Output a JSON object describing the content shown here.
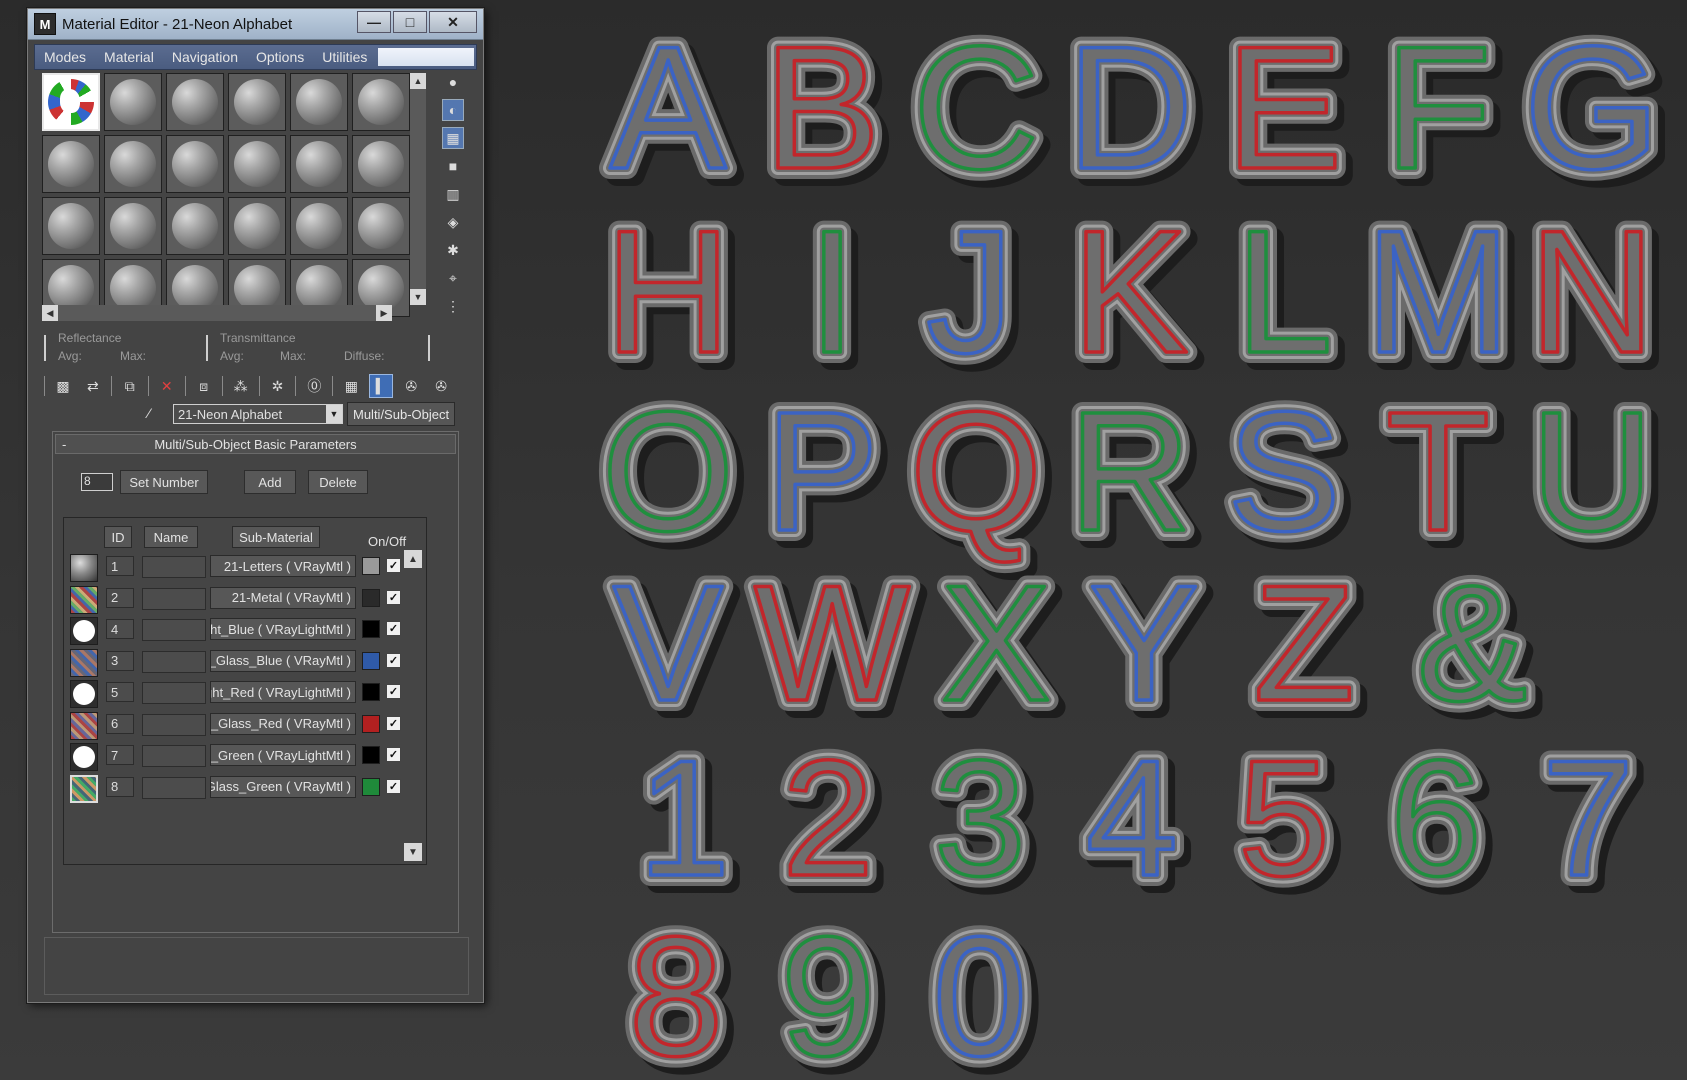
{
  "window": {
    "app_icon": "M",
    "title": "Material Editor - 21-Neon Alphabet",
    "buttons": {
      "minimize": "—",
      "maximize": "□",
      "close": "✕"
    }
  },
  "menu": [
    "Modes",
    "Material",
    "Navigation",
    "Options",
    "Utilities"
  ],
  "reflectance": {
    "label": "Reflectance",
    "avg": "Avg:",
    "max": "Max:"
  },
  "transmittance": {
    "label": "Transmittance",
    "avg": "Avg:",
    "max": "Max:",
    "diffuse": "Diffuse:"
  },
  "material_name": "21-Neon Alphabet",
  "material_type": "Multi/Sub-Object",
  "rollout": {
    "title": "Multi/Sub-Object Basic Parameters",
    "collapse": "-",
    "count_value": "8",
    "set_number": "Set Number",
    "add": "Add",
    "delete": "Delete",
    "headers": {
      "id": "ID",
      "name": "Name",
      "sub_material": "Sub-Material",
      "on_off": "On/Off"
    }
  },
  "rows": [
    {
      "id": "1",
      "material": "21-Letters  ( VRayMtl )",
      "swatch": "#9a9a9a",
      "thumb": "sphere"
    },
    {
      "id": "2",
      "material": "21-Metal  ( VRayMtl )",
      "swatch": "#2a2a2a",
      "thumb": "metal"
    },
    {
      "id": "4",
      "material": "ght_Blue  ( VRayLightMtl )",
      "swatch": "#000000",
      "thumb": "white"
    },
    {
      "id": "3",
      "material": "on_Glass_Blue  ( VRayMtl )",
      "swatch": "#2f5aa8",
      "thumb": "glass-blue"
    },
    {
      "id": "5",
      "material": "ight_Red  ( VRayLightMtl )",
      "swatch": "#000000",
      "thumb": "white"
    },
    {
      "id": "6",
      "material": "on_Glass_Red  ( VRayMtl )",
      "swatch": "#b22020",
      "thumb": "glass-red"
    },
    {
      "id": "7",
      "material": "nt_Green  ( VRayLightMtl )",
      "swatch": "#000000",
      "thumb": "white"
    },
    {
      "id": "8",
      "material": "_Glass_Green  ( VRayMtl )",
      "swatch": "#1f8a3a",
      "thumb": "glass-green"
    }
  ],
  "neon_colors": {
    "blue": "#3b63c4",
    "red": "#c2262b",
    "green": "#1f8f3e"
  },
  "glyphs": [
    {
      "char": "A",
      "color": "blue"
    },
    {
      "char": "B",
      "color": "red"
    },
    {
      "char": "C",
      "color": "green"
    },
    {
      "char": "D",
      "color": "blue"
    },
    {
      "char": "E",
      "color": "red"
    },
    {
      "char": "F",
      "color": "green"
    },
    {
      "char": "G",
      "color": "blue"
    },
    {
      "char": "H",
      "color": "red"
    },
    {
      "char": "I",
      "color": "green"
    },
    {
      "char": "J",
      "color": "blue"
    },
    {
      "char": "K",
      "color": "red"
    },
    {
      "char": "L",
      "color": "green"
    },
    {
      "char": "M",
      "color": "blue"
    },
    {
      "char": "N",
      "color": "red"
    },
    {
      "char": "O",
      "color": "green"
    },
    {
      "char": "P",
      "color": "blue"
    },
    {
      "char": "Q",
      "color": "red"
    },
    {
      "char": "R",
      "color": "green"
    },
    {
      "char": "S",
      "color": "blue"
    },
    {
      "char": "T",
      "color": "red"
    },
    {
      "char": "U",
      "color": "green"
    },
    {
      "char": "V",
      "color": "blue"
    },
    {
      "char": "W",
      "color": "red"
    },
    {
      "char": "X",
      "color": "green"
    },
    {
      "char": "Y",
      "color": "blue"
    },
    {
      "char": "Z",
      "color": "red"
    },
    {
      "char": "&",
      "color": "green"
    },
    {
      "char": "1",
      "color": "blue"
    },
    {
      "char": "2",
      "color": "red"
    },
    {
      "char": "3",
      "color": "green"
    },
    {
      "char": "4",
      "color": "blue"
    },
    {
      "char": "5",
      "color": "red"
    },
    {
      "char": "6",
      "color": "green"
    },
    {
      "char": "7",
      "color": "blue"
    },
    {
      "char": "8",
      "color": "red"
    },
    {
      "char": "9",
      "color": "green"
    },
    {
      "char": "0",
      "color": "blue"
    }
  ]
}
